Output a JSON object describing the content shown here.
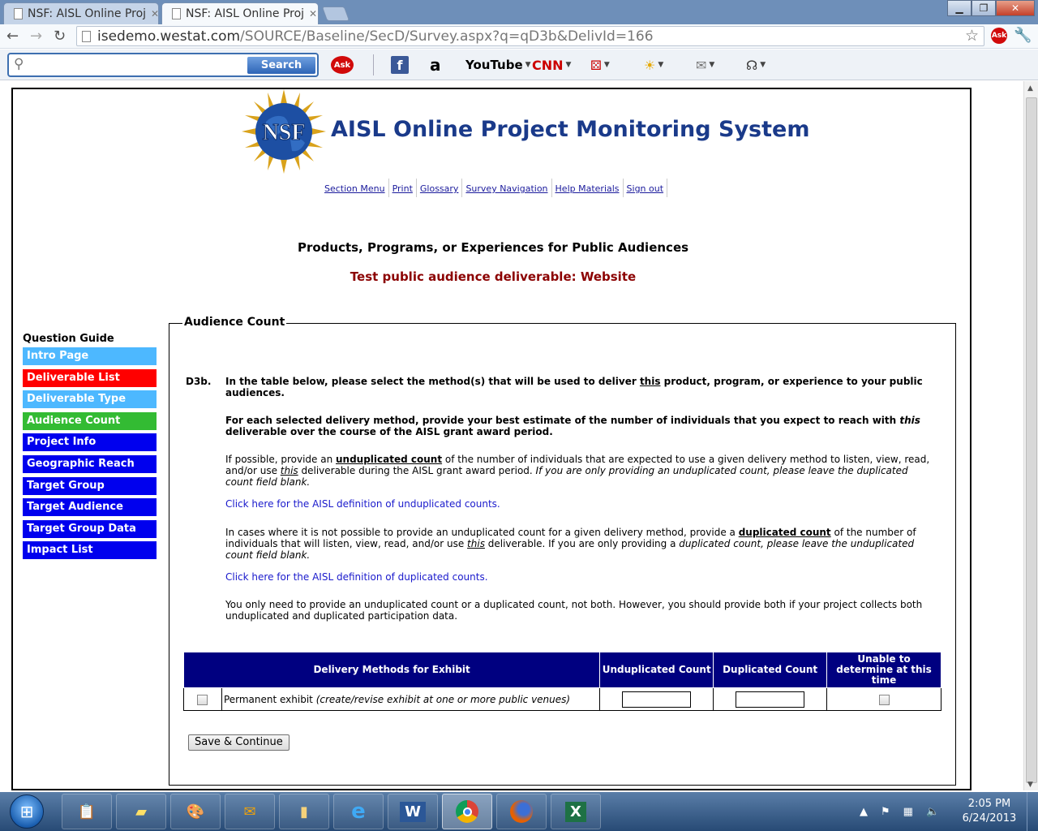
{
  "browser": {
    "tabs": [
      {
        "label": "NSF: AISL Online Proj",
        "active": false
      },
      {
        "label": "NSF: AISL Online Proj",
        "active": true
      }
    ],
    "url_host": "isedemo.westat.com",
    "url_path": "/SOURCE/Baseline/SecD/Survey.aspx?q=qD3b&DelivId=166",
    "toolbar": {
      "search_placeholder": "",
      "search_button": "Search",
      "icons": [
        "ask-icon",
        "facebook-icon",
        "amazon-icon",
        "youtube-icon",
        "cnn-icon",
        "games-icon",
        "weather-icon",
        "mail-icon",
        "horoscope-icon"
      ],
      "youtube_label": "YouTube",
      "cnn_label": "CNN",
      "ask_label": "Ask"
    }
  },
  "site": {
    "logo_text": "NSF",
    "title": "AISL Online Project Monitoring System",
    "menu": [
      "Section Menu",
      "Print",
      "Glossary",
      "Survey Navigation",
      "Help Materials",
      "Sign out"
    ],
    "heading": "Products, Programs, or Experiences for Public Audiences",
    "deliverable": "Test public audience deliverable: Website"
  },
  "sidebar": {
    "label": "Question Guide",
    "items": [
      {
        "label": "Intro Page",
        "color": "#4db8ff"
      },
      {
        "label": "Deliverable List",
        "color": "#ff0000"
      },
      {
        "label": "Deliverable Type",
        "color": "#4db8ff"
      },
      {
        "label": "Audience Count",
        "color": "#33bb33"
      },
      {
        "label": "Project Info",
        "color": "#0000ee"
      },
      {
        "label": "Geographic Reach",
        "color": "#0000ee"
      },
      {
        "label": "Target Group",
        "color": "#0000ee"
      },
      {
        "label": "Target Audience",
        "color": "#0000ee"
      },
      {
        "label": "Target Group Data",
        "color": "#0000ee"
      },
      {
        "label": "Impact List",
        "color": "#0000ee"
      }
    ]
  },
  "section": {
    "legend": "Audience Count",
    "qnum": "D3b.",
    "p1_a": "In the table below, please select the method(s) that will be used to deliver ",
    "p1_b": "this",
    "p1_c": " product, program, or experience to your public audiences.",
    "p2_a": "For each selected delivery method, provide your best estimate of the number of individuals that you expect to reach with ",
    "p2_b": "this",
    "p2_c": " deliverable over the course of the AISL grant award period.",
    "p3_a": "If possible, provide an ",
    "p3_b": "unduplicated count",
    "p3_c": " of the number of individuals that are expected to use a given delivery method to listen, view, read, and/or use ",
    "p3_d": "this",
    "p3_e": " deliverable during the AISL grant award period. ",
    "p3_f": "If you are only providing an unduplicated count, please leave the duplicated count field blank.",
    "link1": "Click here for the AISL definition of unduplicated counts.",
    "p4_a": "In cases where it is not possible to provide an unduplicated count for a given delivery method, provide a ",
    "p4_b": "duplicated count",
    "p4_c": " of the number of individuals that will listen, view, read, and/or use ",
    "p4_d": "this",
    "p4_e": " deliverable. If you are only providing a ",
    "p4_f": "duplicated count, please leave the unduplicated count field blank.",
    "link2": "Click here for the AISL definition of duplicated counts.",
    "p5": "You only need to provide an unduplicated count or a duplicated count, not both. However, you should provide both if your project collects both unduplicated and duplicated participation data.",
    "table": {
      "headers": [
        "Delivery Methods for Exhibit",
        "Unduplicated Count",
        "Duplicated Count",
        "Unable to determine at this time"
      ],
      "rows": [
        {
          "method": "Permanent exhibit ",
          "method_note": "(create/revise exhibit at one or more public venues)",
          "unduplicated": "",
          "duplicated": ""
        }
      ]
    },
    "save_button": "Save & Continue"
  },
  "taskbar": {
    "apps": [
      "task-manager-icon",
      "sticky-notes-icon",
      "paint-icon",
      "outlook-icon",
      "file-explorer-icon",
      "internet-explorer-icon",
      "word-icon",
      "chrome-icon",
      "firefox-icon",
      "excel-icon"
    ],
    "time": "2:05 PM",
    "date": "6/24/2013"
  }
}
